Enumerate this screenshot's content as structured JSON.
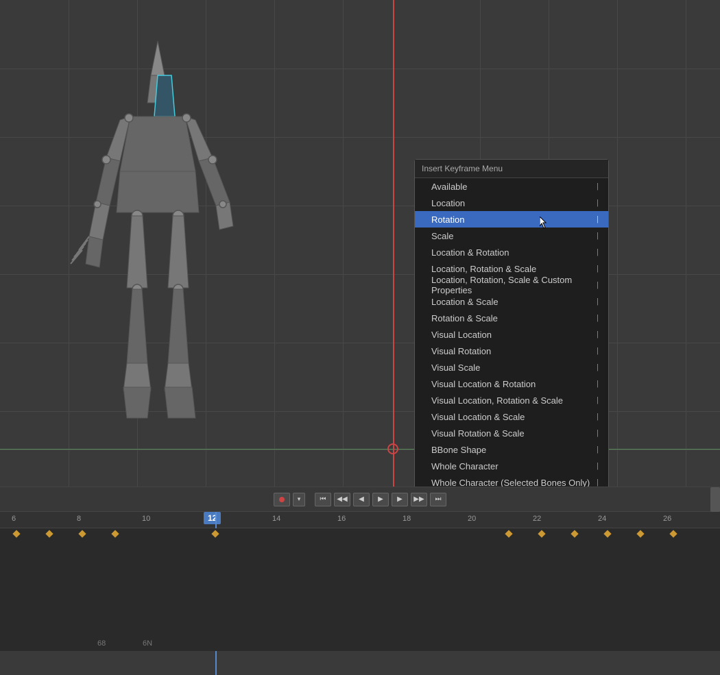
{
  "viewport": {
    "background": "#3a3a3a"
  },
  "menu": {
    "title": "Insert Keyframe Menu",
    "items": [
      {
        "id": "available",
        "label": "Available",
        "has_arrow": true,
        "active": false
      },
      {
        "id": "location",
        "label": "Location",
        "has_arrow": true,
        "active": false
      },
      {
        "id": "rotation",
        "label": "Rotation",
        "has_arrow": true,
        "active": true
      },
      {
        "id": "scale",
        "label": "Scale",
        "has_arrow": true,
        "active": false
      },
      {
        "id": "location-rotation",
        "label": "Location & Rotation",
        "has_arrow": true,
        "active": false
      },
      {
        "id": "location-rotation-scale",
        "label": "Location, Rotation & Scale",
        "has_arrow": true,
        "active": false
      },
      {
        "id": "location-rotation-scale-custom",
        "label": "Location, Rotation, Scale & Custom Properties",
        "has_arrow": true,
        "active": false
      },
      {
        "id": "location-scale",
        "label": "Location & Scale",
        "has_arrow": true,
        "active": false
      },
      {
        "id": "rotation-scale",
        "label": "Rotation & Scale",
        "has_arrow": true,
        "active": false
      },
      {
        "id": "visual-location",
        "label": "Visual Location",
        "has_arrow": true,
        "active": false
      },
      {
        "id": "visual-rotation",
        "label": "Visual Rotation",
        "has_arrow": true,
        "active": false
      },
      {
        "id": "visual-scale",
        "label": "Visual Scale",
        "has_arrow": true,
        "active": false
      },
      {
        "id": "visual-location-rotation",
        "label": "Visual Location & Rotation",
        "has_arrow": true,
        "active": false
      },
      {
        "id": "visual-location-rotation-scale",
        "label": "Visual Location, Rotation & Scale",
        "has_arrow": true,
        "active": false
      },
      {
        "id": "visual-location-scale",
        "label": "Visual Location & Scale",
        "has_arrow": true,
        "active": false
      },
      {
        "id": "visual-rotation-scale",
        "label": "Visual Rotation & Scale",
        "has_arrow": true,
        "active": false
      },
      {
        "id": "bbone-shape",
        "label": "BBone Shape",
        "has_arrow": true,
        "active": false
      },
      {
        "id": "whole-character",
        "label": "Whole Character",
        "has_arrow": true,
        "active": false
      },
      {
        "id": "whole-character-selected",
        "label": "Whole Character (Selected Bones Only)",
        "has_arrow": true,
        "active": false
      }
    ]
  },
  "timeline": {
    "current_frame": "12",
    "markers": [
      "6",
      "8",
      "10",
      "12",
      "14",
      "16",
      "18",
      "20",
      "22",
      "24",
      "26"
    ],
    "controls": {
      "record_label": "●",
      "first_label": "⏮",
      "prev_label": "◀◀",
      "prev_frame_label": "◀",
      "play_label": "▶",
      "next_frame_label": "▶",
      "next_label": "▶▶",
      "last_label": "⏭"
    }
  },
  "bottom": {
    "left_text": "68",
    "right_text": "6N"
  }
}
